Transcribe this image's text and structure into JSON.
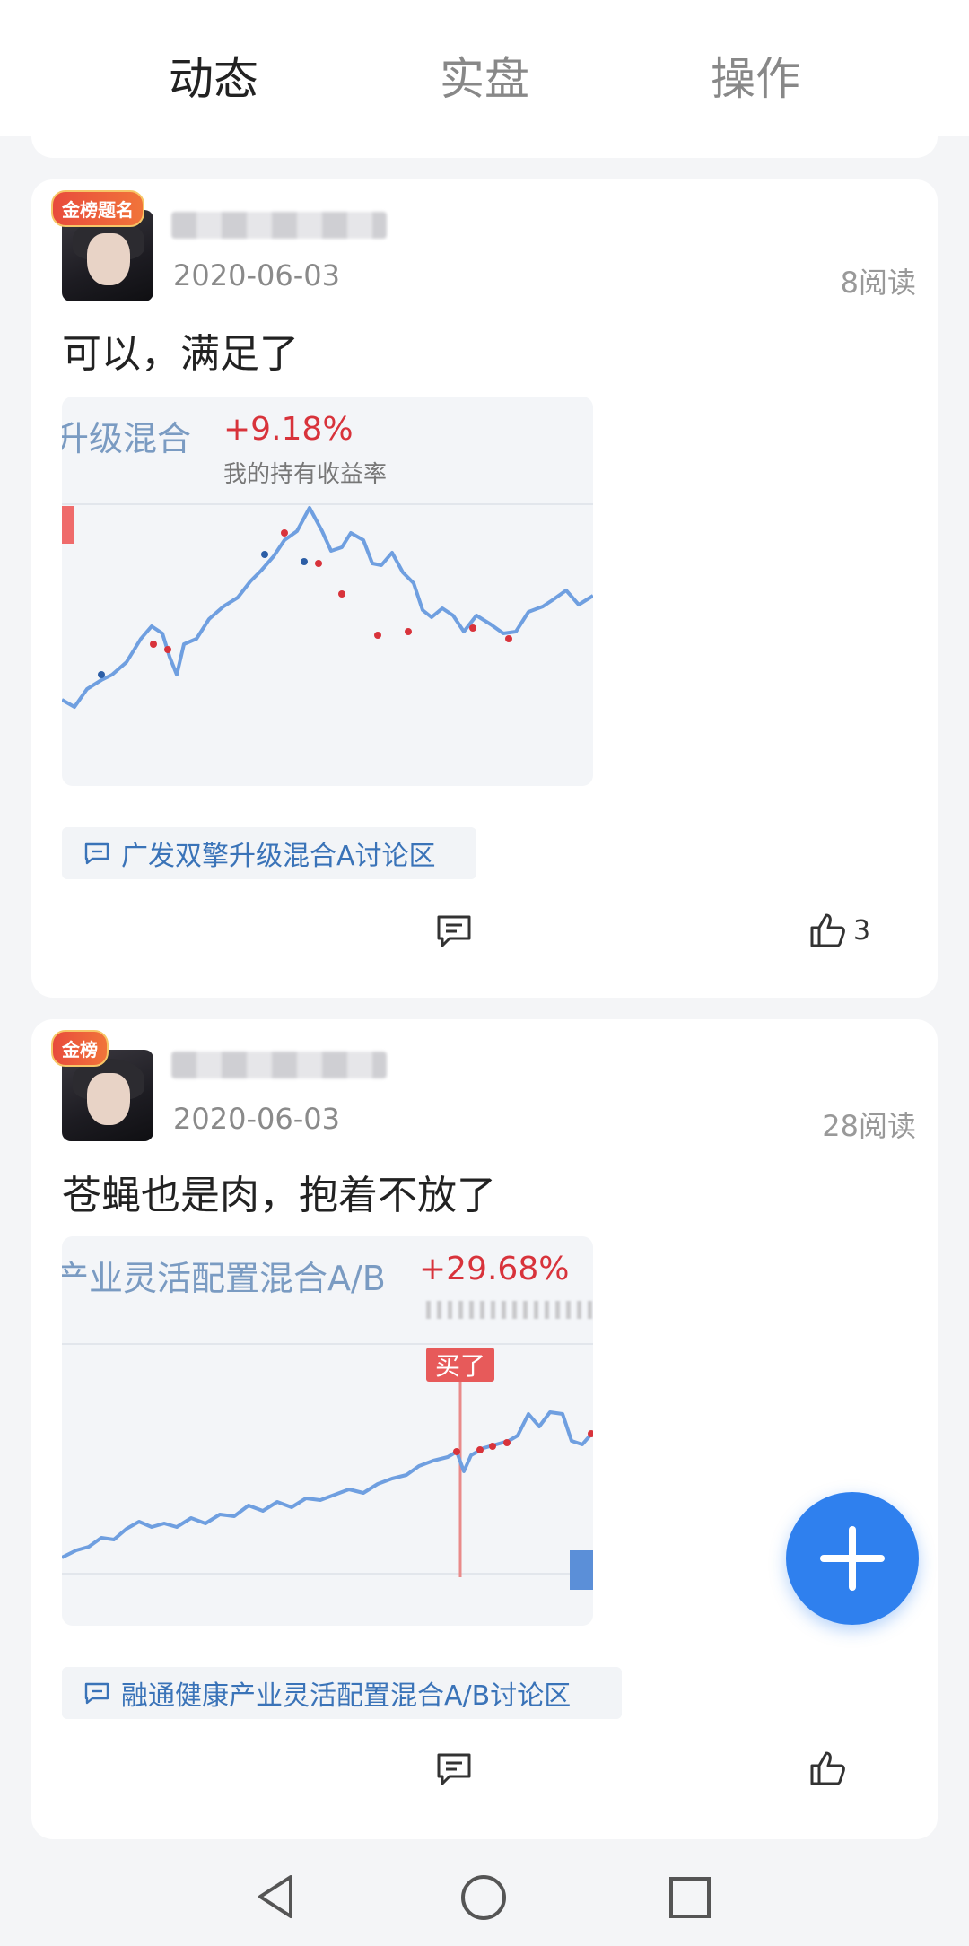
{
  "tabs": [
    {
      "label": "动态",
      "active": true
    },
    {
      "label": "实盘",
      "active": false
    },
    {
      "label": "操作",
      "active": false
    }
  ],
  "posts": [
    {
      "date": "2020-06-03",
      "reads": "8阅读",
      "text": "可以，满足了",
      "avatar_badge": "金榜题名",
      "chart": {
        "title": "升级混合",
        "pct": "+9.18%",
        "sub": "我的持有收益率"
      },
      "topic": "广发双擎升级混合A讨论区",
      "like_count": "3"
    },
    {
      "date": "2020-06-03",
      "reads": "28阅读",
      "text": "苍蝇也是肉，抱着不放了",
      "avatar_badge": "金榜",
      "chart": {
        "title": "产业灵活配置混合A/B",
        "pct": "+29.68%",
        "marker": "买了"
      },
      "topic": "融通健康产业灵活配置混合A/B讨论区",
      "like_count": ""
    }
  ],
  "colors": {
    "accent": "#2f80ee",
    "line": "#6f9fe0",
    "gain": "#d8333b",
    "topic": "#3a73b8"
  },
  "icons": {
    "comment": "comment-icon",
    "like": "thumb-up-icon",
    "fab": "plus-icon",
    "nav_back": "triangle-back-icon",
    "nav_home": "circle-home-icon",
    "nav_recent": "square-recent-icon"
  }
}
